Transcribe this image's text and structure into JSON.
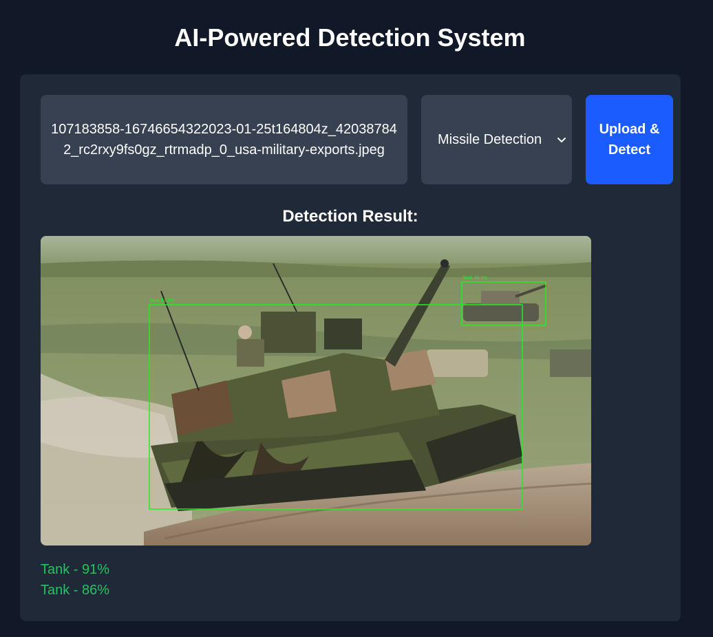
{
  "header": {
    "title": "AI-Powered Detection System"
  },
  "controls": {
    "file_name": "107183858-16746654322023-01-25t164804z_420387842_rc2rxy9fs0gz_rtrmadp_0_usa-military-exports.jpeg",
    "model_select": {
      "selected": "Missile Detection"
    },
    "upload_button_label": "Upload & Detect"
  },
  "result": {
    "heading": "Detection Result:",
    "boxes": [
      {
        "label": "Tank 91.0%"
      },
      {
        "label": "Tank 86.0%"
      }
    ],
    "detections": [
      "Tank - 91%",
      "Tank - 86%"
    ]
  },
  "colors": {
    "background": "#111827",
    "panel": "#1f2937",
    "field": "#374151",
    "accent": "#1a5cff",
    "detection_text": "#22c55e",
    "box_stroke": "#22ee22"
  },
  "icons": {
    "select_chevron": "chevron-down-icon"
  }
}
